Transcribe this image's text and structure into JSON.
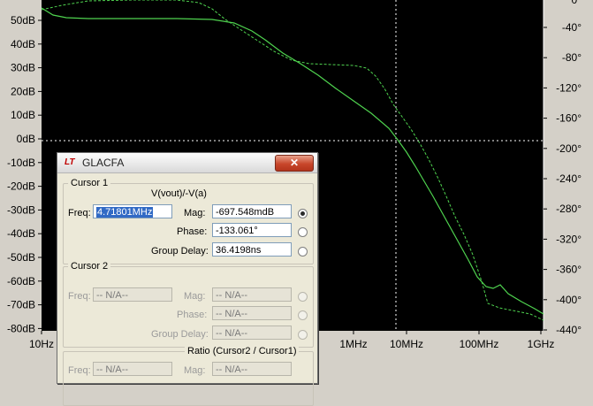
{
  "plot": {
    "y_left_ticks": [
      "50dB",
      "40dB",
      "30dB",
      "20dB",
      "10dB",
      "0dB",
      "-10dB",
      "-20dB",
      "-30dB",
      "-40dB",
      "-50dB",
      "-60dB",
      "-70dB",
      "-80dB"
    ],
    "y_right_ticks": [
      "-40°",
      "-80°",
      "-120°",
      "-160°",
      "-200°",
      "-240°",
      "-280°",
      "-320°",
      "-360°",
      "-400°",
      "-440°"
    ],
    "x_ticks": [
      "10Hz",
      "1MHz",
      "10MHz",
      "100MHz",
      "1GHz"
    ],
    "top_right_partial_tick": "0°",
    "colors": {
      "background": "#000000",
      "trace": "#4fd34f",
      "grid": "#ffffff",
      "axis_panel": "#d4d0c8"
    }
  },
  "dialog": {
    "title": "GLACFA",
    "close_label": "✕",
    "cursor1": {
      "legend": "Cursor 1",
      "expression": "V(vout)/-V(a)",
      "freq_label": "Freq:",
      "freq_value": "4.71801MHz",
      "mag_label": "Mag:",
      "mag_value": "-697.548mdB",
      "phase_label": "Phase:",
      "phase_value": "-133.061°",
      "group_delay_label": "Group Delay:",
      "group_delay_value": "36.4198ns"
    },
    "cursor2": {
      "legend": "Cursor 2",
      "freq_label": "Freq:",
      "freq_value": "-- N/A--",
      "mag_label": "Mag:",
      "mag_value": "-- N/A--",
      "phase_label": "Phase:",
      "phase_value": "-- N/A--",
      "group_delay_label": "Group Delay:",
      "group_delay_value": "-- N/A--"
    },
    "ratio": {
      "legend": "Ratio (Cursor2 / Cursor1)",
      "freq_label": "Freq:",
      "freq_value": "-- N/A--",
      "mag_label": "Mag:",
      "mag_value": "-- N/A--"
    }
  }
}
